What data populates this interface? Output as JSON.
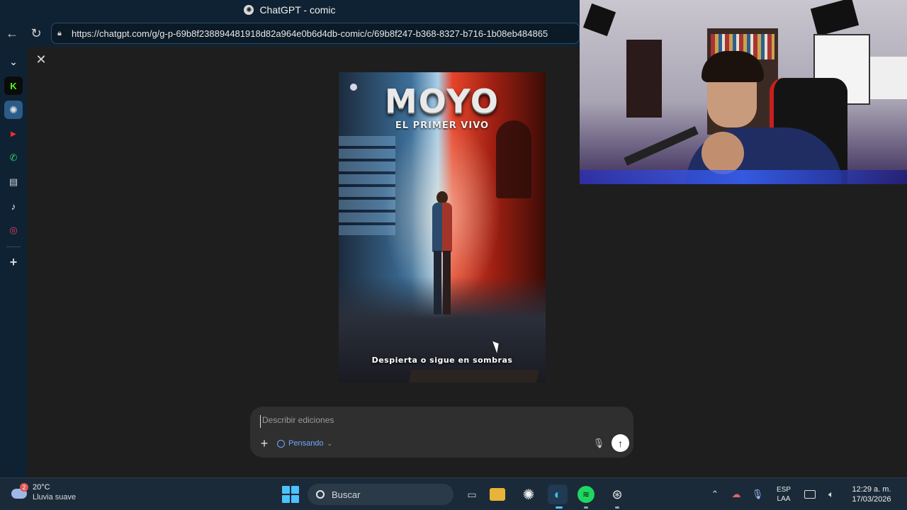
{
  "browser": {
    "window_title": "ChatGPT - comic",
    "url": "https://chatgpt.com/g/g-p-69b8f238894481918d82a964e0b6d4db-comic/c/69b8f247-b368-8327-b716-1b08eb484865",
    "sidebar_apps": [
      {
        "name": "collapse",
        "glyph": "⌄",
        "color": "#cfd6dd"
      },
      {
        "name": "kick",
        "glyph": "K",
        "color": "#53fc18"
      },
      {
        "name": "chatgpt",
        "glyph": "✺",
        "color": "#e0e0e0"
      },
      {
        "name": "youtube",
        "glyph": "▶",
        "color": "#ff2b2b"
      },
      {
        "name": "whatsapp",
        "glyph": "✆",
        "color": "#25d366"
      },
      {
        "name": "calendar",
        "glyph": "▤",
        "color": "#cfd6dd"
      },
      {
        "name": "tiktok",
        "glyph": "♪",
        "color": "#ffffff"
      },
      {
        "name": "instagram",
        "glyph": "◎",
        "color": "#e4405f"
      },
      {
        "name": "add",
        "glyph": "+",
        "color": "#cfd6dd"
      }
    ]
  },
  "comic_cover": {
    "title": "MOYO",
    "subtitle": "EL PRIMER VIVO",
    "tagline": "Despierta o sigue en sombras"
  },
  "composer": {
    "placeholder": "Describir ediciones",
    "mode_label": "Pensando"
  },
  "taskbar": {
    "weather_temp": "20°C",
    "weather_condition": "Lluvia suave",
    "weather_badge": "2",
    "search_label": "Buscar",
    "language_line1": "ESP",
    "language_line2": "LAA",
    "time": "12:29 a. m.",
    "date": "17/03/2026"
  },
  "colors": {
    "accent_blue": "#6ea8ff",
    "windows_blue": "#4cc2ff",
    "spotify_green": "#1ed760"
  }
}
